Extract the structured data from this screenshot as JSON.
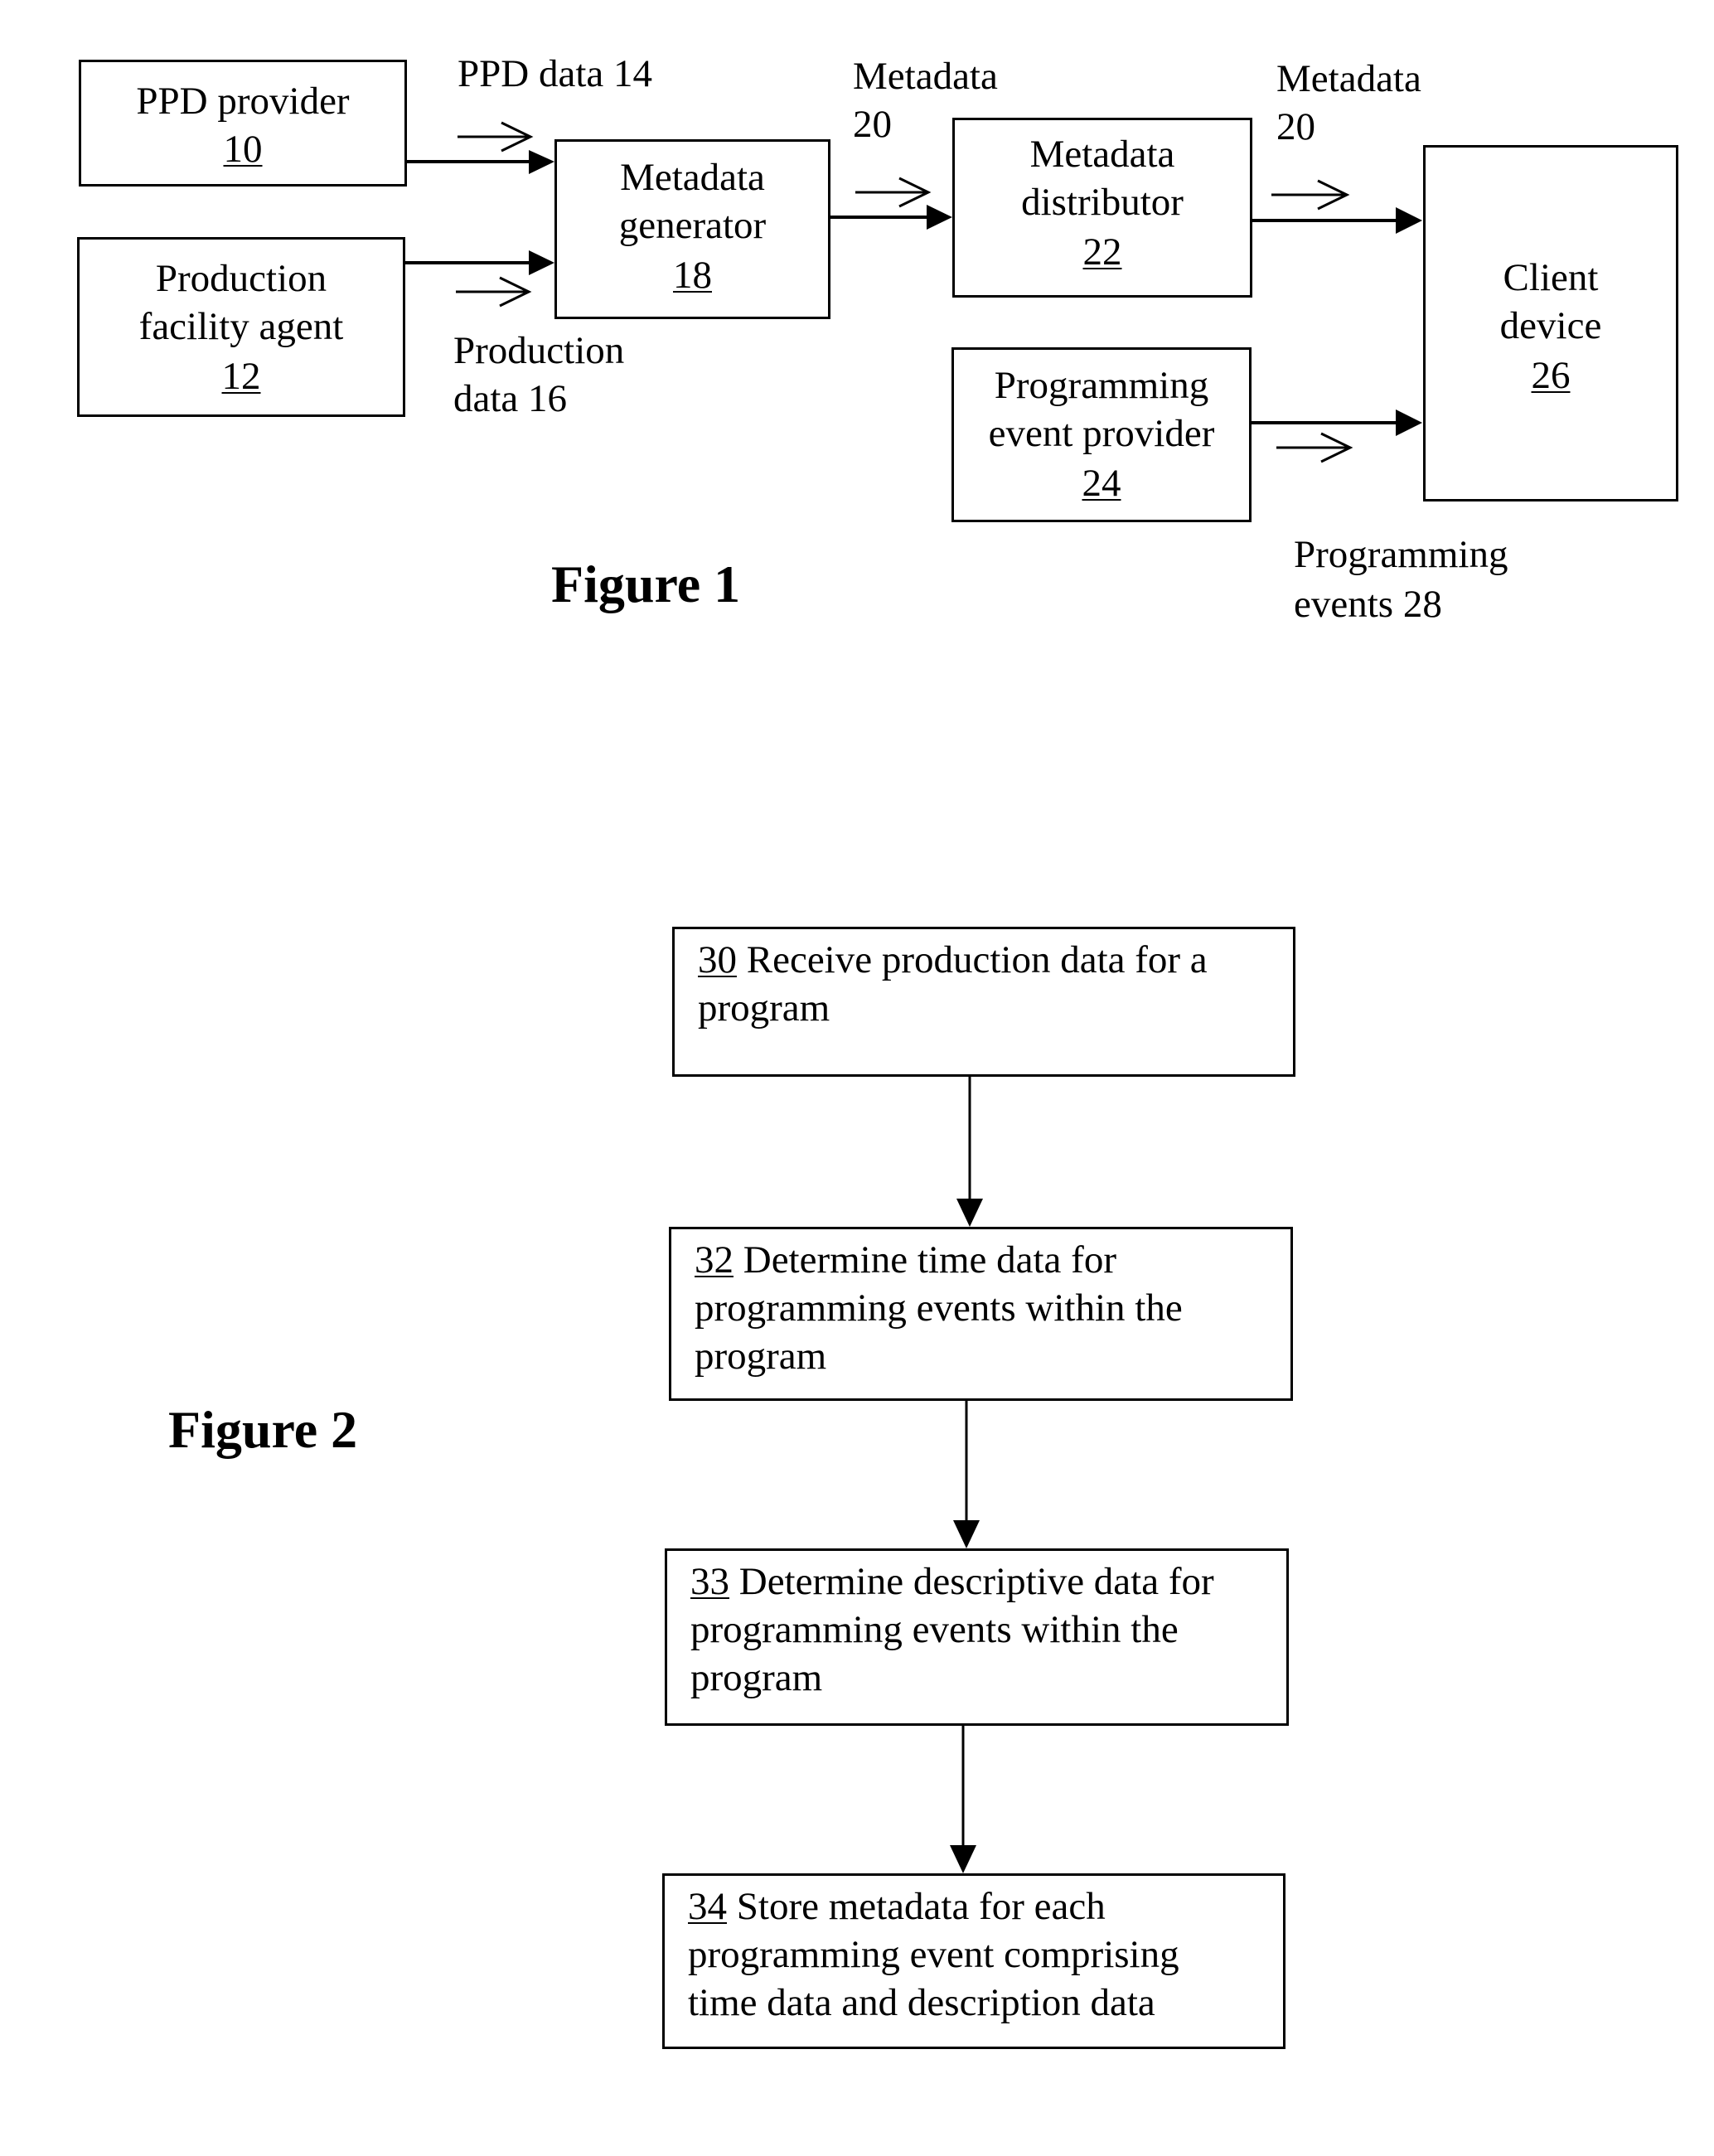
{
  "figure1": {
    "caption": "Figure 1",
    "blocks": {
      "ppd_provider": {
        "name": "PPD provider",
        "ref": "10"
      },
      "production_agent": {
        "line1": "Production",
        "line2": "facility agent",
        "ref": "12"
      },
      "metadata_generator": {
        "line1": "Metadata",
        "line2": "generator",
        "ref": "18"
      },
      "metadata_distributor": {
        "line1": "Metadata",
        "line2": "distributor",
        "ref": "22"
      },
      "event_provider": {
        "line1": "Programming",
        "line2": "event provider",
        "ref": "24"
      },
      "client_device": {
        "line1": "Client",
        "line2": "device",
        "ref": "26"
      }
    },
    "flow_labels": {
      "ppd_data": "PPD data 14",
      "production_data_1": "Production",
      "production_data_2": "data 16",
      "metadata_a_1": "Metadata",
      "metadata_a_2": "20",
      "metadata_b_1": "Metadata",
      "metadata_b_2": "20",
      "prog_events_1": "Programming",
      "prog_events_2": "events 28"
    },
    "connections": [
      {
        "from": "PPD provider 10",
        "to": "Metadata generator 18",
        "label": "PPD data 14"
      },
      {
        "from": "Production facility agent 12",
        "to": "Metadata generator 18",
        "label": "Production data 16"
      },
      {
        "from": "Metadata generator 18",
        "to": "Metadata distributor 22",
        "label": "Metadata 20"
      },
      {
        "from": "Metadata distributor 22",
        "to": "Client device 26",
        "label": "Metadata 20"
      },
      {
        "from": "Programming event provider 24",
        "to": "Client device 26",
        "label": "Programming events 28"
      }
    ]
  },
  "figure2": {
    "caption": "Figure 2",
    "steps": [
      {
        "ref": "30",
        "lines": [
          "Receive production data for a",
          "program"
        ]
      },
      {
        "ref": "32",
        "lines": [
          "Determine time data for",
          "programming events within the",
          "program"
        ]
      },
      {
        "ref": "33",
        "lines": [
          "Determine descriptive data for",
          "programming events within the",
          "program"
        ]
      },
      {
        "ref": "34",
        "lines": [
          "Store metadata for each",
          "programming event comprising",
          "time data and description data"
        ]
      }
    ]
  }
}
